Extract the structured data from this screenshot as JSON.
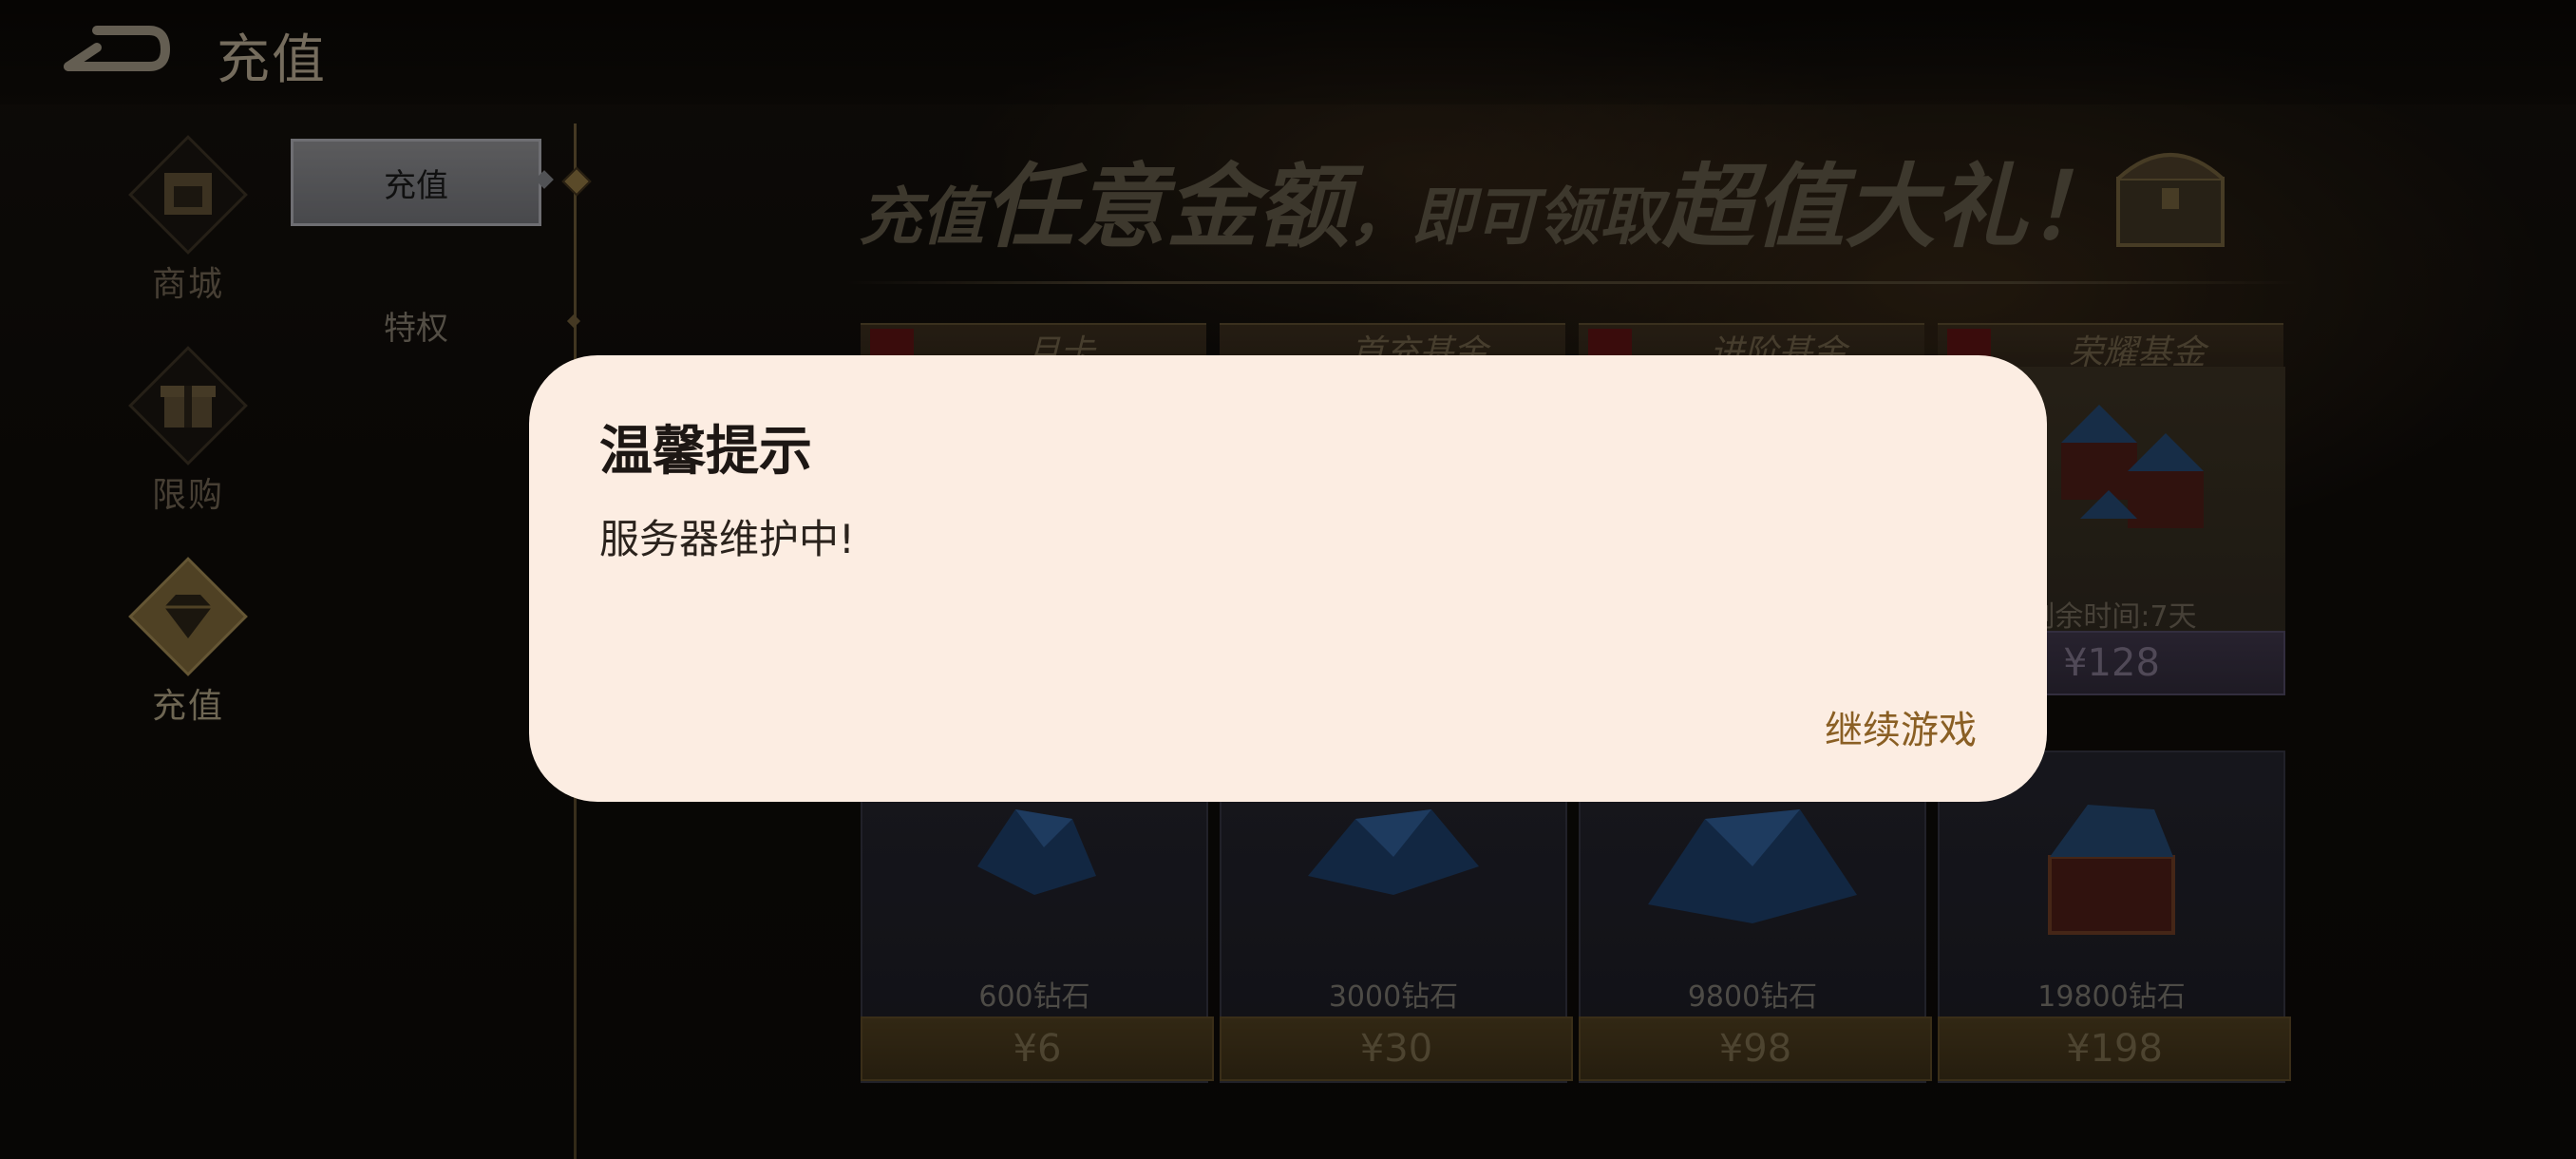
{
  "topbar": {
    "title": "充值",
    "back_icon": "back-arrow-icon"
  },
  "leftnav": [
    {
      "label": "商城",
      "icon": "shop-icon"
    },
    {
      "label": "限购",
      "icon": "gift-icon"
    },
    {
      "label": "充值",
      "icon": "diamond-icon",
      "active": true
    }
  ],
  "subtabs": {
    "active": "充值",
    "second": "特权"
  },
  "banner": {
    "part1": "充值",
    "part2": "任意金额",
    "part3": "，即可领取",
    "part4": "超值大礼！"
  },
  "funds": [
    "月卡",
    "首充基金",
    "进阶基金",
    "荣耀基金"
  ],
  "glory_card": {
    "remaining": "剩余时间:7天",
    "price": "¥128"
  },
  "diamond_cards": [
    {
      "amount": "600钻石",
      "price": "¥6"
    },
    {
      "amount": "3000钻石",
      "price": "¥30"
    },
    {
      "amount": "9800钻石",
      "price": "¥98"
    },
    {
      "amount": "19800钻石",
      "price": "¥198"
    }
  ],
  "dialog": {
    "title": "温馨提示",
    "message": "服务器维护中!",
    "button": "继续游戏"
  },
  "colors": {
    "dialog_bg": "#fcede2",
    "button_text": "#8a5f24",
    "accent_gold": "#8b7240"
  }
}
